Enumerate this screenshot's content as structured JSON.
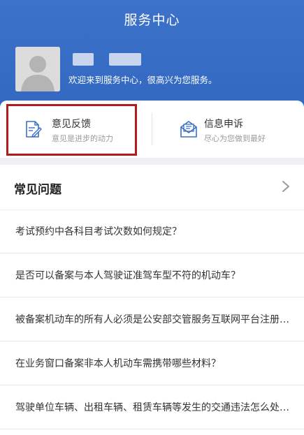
{
  "header": {
    "title": "服务中心",
    "welcome": "欢迎来到服务中心，很高兴为您服务。"
  },
  "actions": [
    {
      "title": "意见反馈",
      "subtitle": "意见是进步的动力",
      "icon": "feedback-edit-icon"
    },
    {
      "title": "信息申诉",
      "subtitle": "尽心为您做到最好",
      "icon": "mail-appeal-icon"
    }
  ],
  "faq": {
    "title": "常见问题",
    "items": [
      "考试预约中各科目考试次数如何规定？",
      "是否可以备案与本人驾驶证准驾车型不符的机动车？",
      "被备案机动车的所有人必须是公安部交管服务互联网平台注册用户吗？",
      "在业务窗口备案非本人机动车需携带哪些材料？",
      "驾驶单位车辆、出租车辆、租赁车辆等发生的交通违法怎么处理？"
    ]
  },
  "colors": {
    "header_blue": "#3a6fc6",
    "highlight_red": "#b31b1b",
    "icon_blue": "#3a6fc6"
  }
}
